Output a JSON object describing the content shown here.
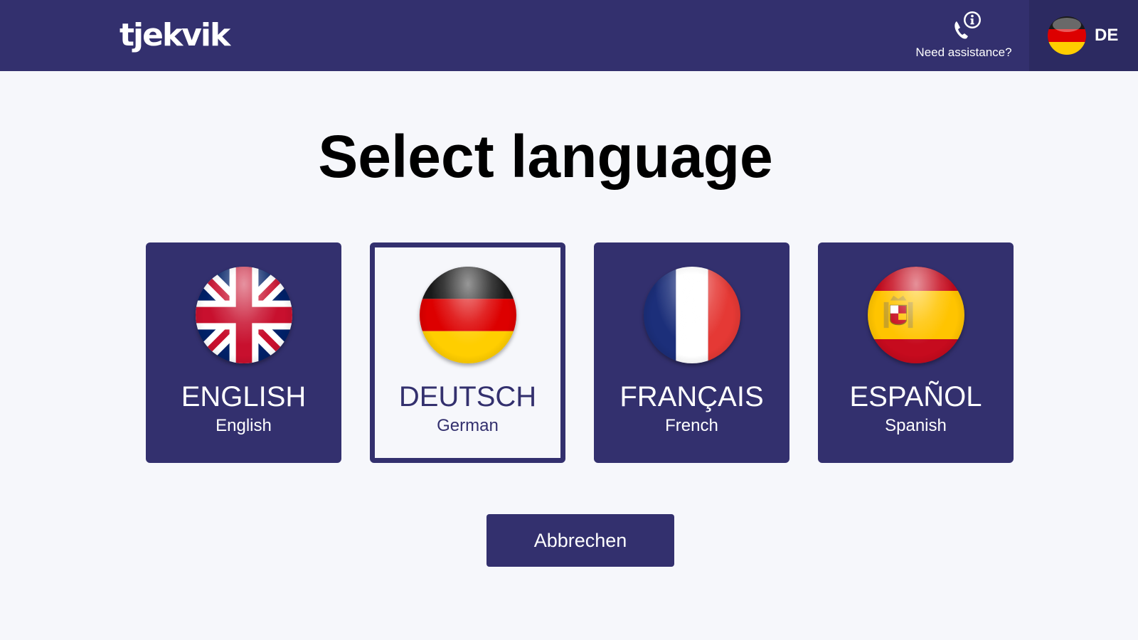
{
  "header": {
    "logo_text": "tjekvik",
    "assistance_label": "Need assistance?",
    "current_language_code": "DE"
  },
  "title": "Select language",
  "languages": [
    {
      "name": "ENGLISH",
      "sub": "English",
      "flag_icon": "uk-flag-icon",
      "selected": false
    },
    {
      "name": "DEUTSCH",
      "sub": "German",
      "flag_icon": "germany-flag-icon",
      "selected": true
    },
    {
      "name": "FRANÇAIS",
      "sub": "French",
      "flag_icon": "france-flag-icon",
      "selected": false
    },
    {
      "name": "ESPAÑOL",
      "sub": "Spanish",
      "flag_icon": "spain-flag-icon",
      "selected": false
    }
  ],
  "cancel_label": "Abbrechen",
  "colors": {
    "brand": "#33306e",
    "background": "#f6f7fb",
    "lang_switch_bg": "#2c2a61"
  }
}
